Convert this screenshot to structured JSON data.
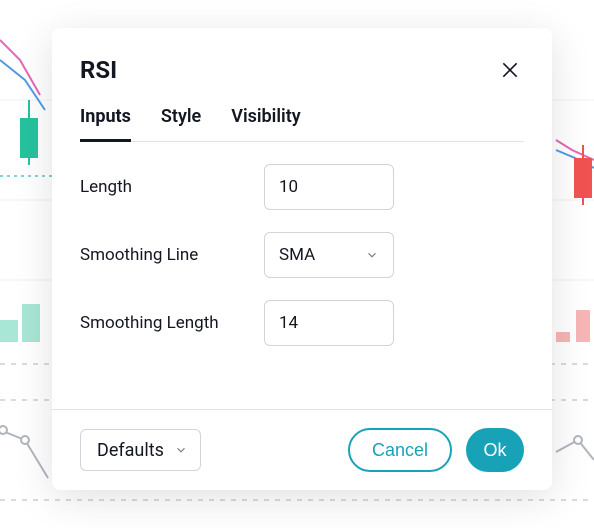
{
  "modal": {
    "title": "RSI",
    "tabs": [
      {
        "label": "Inputs",
        "active": true
      },
      {
        "label": "Style",
        "active": false
      },
      {
        "label": "Visibility",
        "active": false
      }
    ],
    "fields": {
      "length": {
        "label": "Length",
        "value": "10"
      },
      "smoothing_line": {
        "label": "Smoothing Line",
        "value": "SMA"
      },
      "smoothing_length": {
        "label": "Smoothing Length",
        "value": "14"
      }
    },
    "footer": {
      "defaults_label": "Defaults",
      "cancel_label": "Cancel",
      "ok_label": "Ok"
    }
  },
  "background": {
    "colors": {
      "line_pink": "#e667b5",
      "line_blue": "#4f9ae6",
      "candle_green": "#26c29e",
      "candle_red": "#f05252",
      "pale_green": "#a8e6d5",
      "pale_red": "#f7b5b5",
      "grid": "#e6e8ec",
      "dashed": "#b0b5be",
      "cyan_dashed": "#7fd3d8"
    }
  }
}
